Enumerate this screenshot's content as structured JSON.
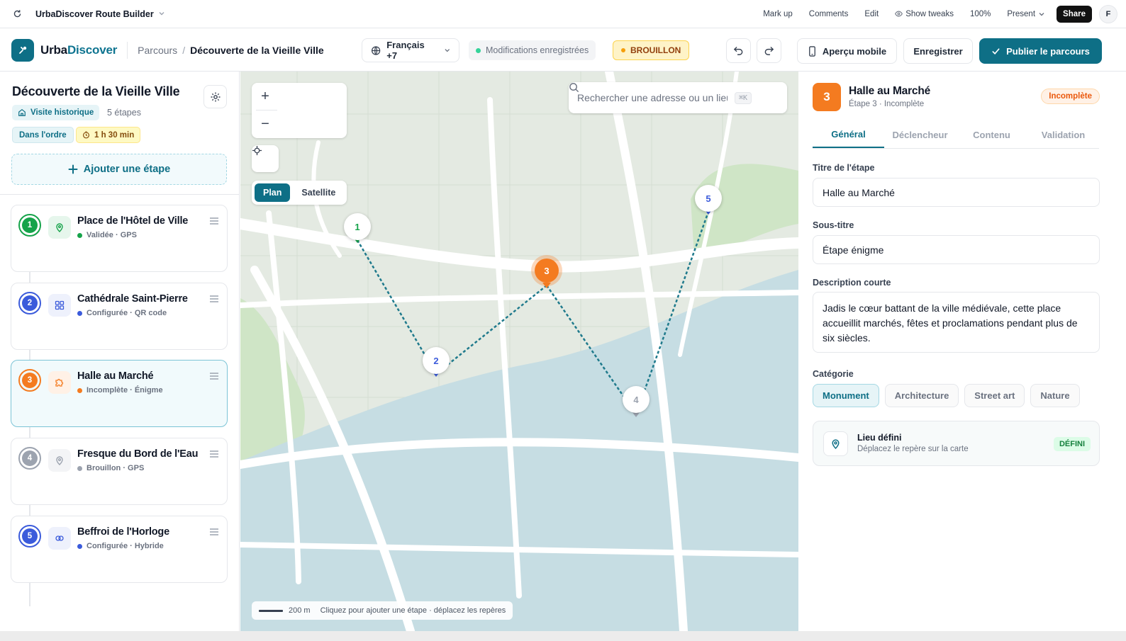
{
  "topbar": {
    "app_title": "UrbaDiscover Route Builder",
    "markup": "Mark up",
    "comments": "Comments",
    "edit": "Edit",
    "show_tweaks": "Show tweaks",
    "zoom": "100%",
    "present": "Present",
    "share": "Share",
    "avatar": "F"
  },
  "header": {
    "brand_a": "Urba",
    "brand_b": "Discover",
    "breadcrumb_root": "Parcours",
    "breadcrumb_current": "Découverte de la Vieille Ville",
    "language": "Français +7",
    "save_status": "Modifications enregistrées",
    "draft_badge": "BROUILLON",
    "mobile_preview": "Aperçu mobile",
    "save": "Enregistrer",
    "publish": "Publier le parcours"
  },
  "colors": {
    "accent": "#0e6f86",
    "validated": "#16a34a",
    "configured": "#3b5bdb",
    "incomplete": "#f47b20",
    "draft": "#9ca3af"
  },
  "route": {
    "title": "Découverte de la Vieille Ville",
    "theme": "Visite historique",
    "steps_count": "5 étapes",
    "order": "Dans l'ordre",
    "duration": "1 h 30 min",
    "add_step": "Ajouter une étape"
  },
  "steps": [
    {
      "number": "1",
      "name": "Place de l'Hôtel de Ville",
      "status": "Validée · GPS",
      "icon": "location-pin-icon"
    },
    {
      "number": "2",
      "name": "Cathédrale Saint-Pierre",
      "status": "Configurée · QR code",
      "icon": "qr-code-icon"
    },
    {
      "number": "3",
      "name": "Halle au Marché",
      "status": "Incomplète · Énigme",
      "icon": "puzzle-icon"
    },
    {
      "number": "4",
      "name": "Fresque du Bord de l'Eau",
      "status": "Brouillon · GPS",
      "icon": "location-pin-icon"
    },
    {
      "number": "5",
      "name": "Beffroi de l'Horloge",
      "status": "Configurée · Hybride",
      "icon": "hybrid-icon"
    }
  ],
  "map": {
    "zoom_in": "+",
    "zoom_out": "−",
    "plan": "Plan",
    "satellite": "Satellite",
    "search_placeholder": "Rechercher une adresse ou un lieu",
    "search_shortcut": "⌘K",
    "scale": "200 m",
    "hint": "Cliquez pour ajouter une étape · déplacez les repères"
  },
  "editor": {
    "badge": "3",
    "title": "Halle au Marché",
    "subtitle": "Étape 3 · Incomplète",
    "state": "Incomplète",
    "tabs": [
      "Général",
      "Déclencheur",
      "Contenu",
      "Validation"
    ],
    "title_label": "Titre de l'étape",
    "title_value": "Halle au Marché",
    "subtitle_label": "Sous-titre",
    "subtitle_value": "Étape énigme",
    "desc_label": "Description courte",
    "desc_value": "Jadis le cœur battant de la ville médiévale, cette place accueillit marchés, fêtes et proclamations pendant plus de six siècles.",
    "category_label": "Catégorie",
    "categories": [
      "Monument",
      "Architecture",
      "Street art",
      "Nature"
    ],
    "place_title": "Lieu défini",
    "place_sub": "Déplacez le repère sur la carte",
    "place_badge": "DÉFINI"
  }
}
